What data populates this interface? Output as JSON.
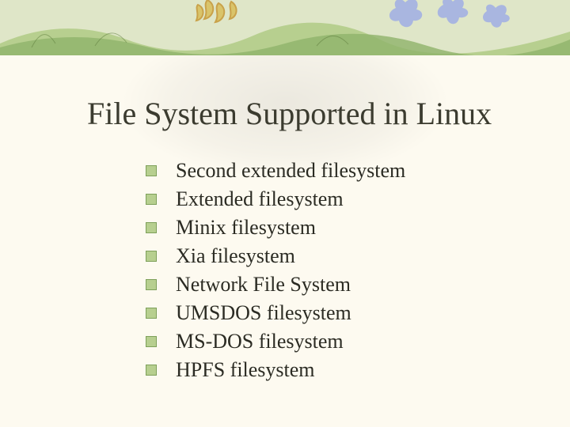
{
  "title": "File System Supported in Linux",
  "items": [
    {
      "label": "Second extended filesystem"
    },
    {
      "label": "Extended filesystem"
    },
    {
      "label": "Minix filesystem"
    },
    {
      "label": "Xia filesystem"
    },
    {
      "label": "Network File System"
    },
    {
      "label": "UMSDOS filesystem"
    },
    {
      "label": "MS-DOS filesystem"
    },
    {
      "label": "HPFS filesystem"
    }
  ]
}
